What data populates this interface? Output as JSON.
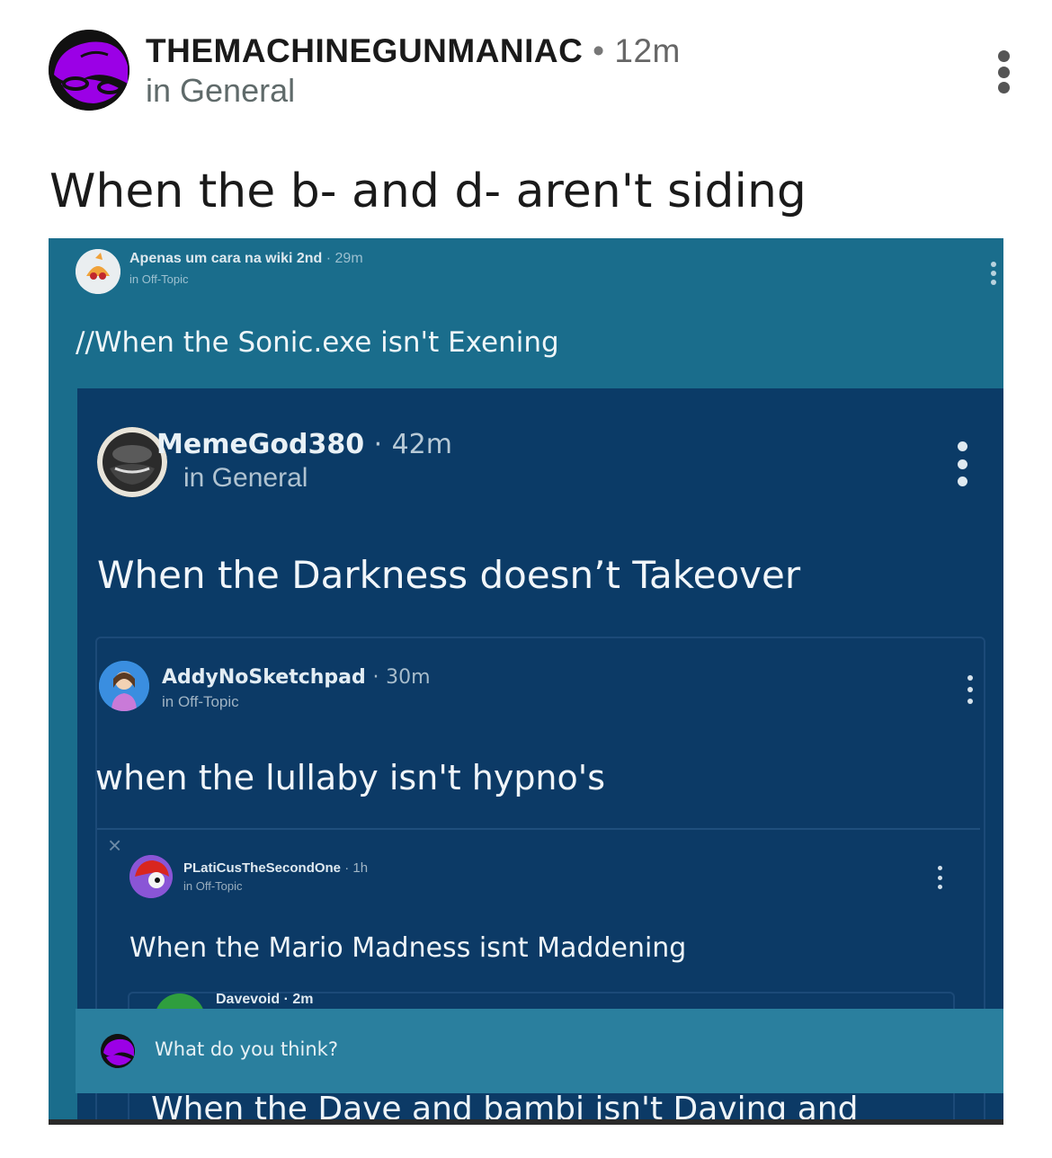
{
  "post": {
    "author": "THEMACHINEGUNMANIAC",
    "separator": "•",
    "time": "12m",
    "channel": "in General",
    "title": "When the b- and d- aren't siding"
  },
  "embedded": {
    "level1": {
      "author": "Apenas um cara na wiki 2nd",
      "separator": "·",
      "time": "29m",
      "channel": "in Off-Topic",
      "title": "//When the Sonic.exe isn't Exening"
    },
    "level2": {
      "author": "MemeGod380",
      "separator": "·",
      "time": "42m",
      "channel": "in General",
      "title": "When the Darkness doesn’t Takeover"
    },
    "level3": {
      "author": "AddyNoSketchpad",
      "separator": "·",
      "time": "30m",
      "channel": "in Off-Topic",
      "title": "when the lullaby isn't hypno's"
    },
    "level4": {
      "close_glyph": "×",
      "author": "PLatiCusTheSecondOne",
      "separator": "·",
      "time": "1h",
      "channel": "in Off-Topic",
      "title": "When the Mario Madness isnt Maddening"
    },
    "level5": {
      "author": "Davevoid",
      "separator": "·",
      "time": "2m",
      "title": "When the Dave and bambi isn't Daving and"
    },
    "comment_prompt": "What do you think?"
  },
  "colors": {
    "accent_purple": "#9b00e6",
    "screenshot_teal": "#1a6d8c",
    "screenshot_navy": "#0b3b67"
  }
}
